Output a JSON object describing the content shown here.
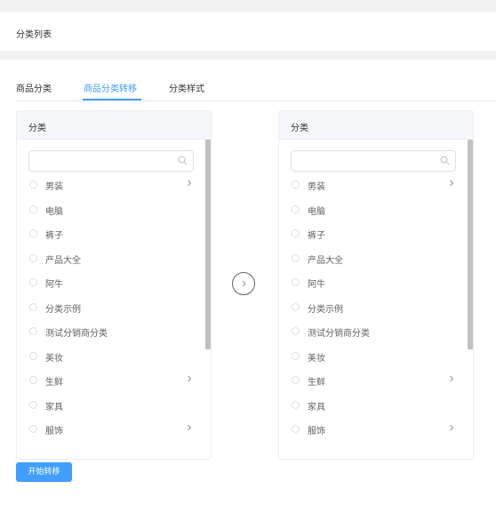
{
  "header": {
    "title": "分类列表"
  },
  "tabs": [
    {
      "label": "商品分类"
    },
    {
      "label": "商品分类转移"
    },
    {
      "label": "分类样式"
    }
  ],
  "colors": {
    "accent": "#409eff",
    "header_bg": "#f5f7fa",
    "page_bg": "#f2f2f2"
  },
  "left_panel": {
    "header": "分类",
    "items": [
      {
        "label": "男装",
        "has_children": true
      },
      {
        "label": "电脑",
        "has_children": false
      },
      {
        "label": "裤子",
        "has_children": false
      },
      {
        "label": "产品大全",
        "has_children": false
      },
      {
        "label": "阿牛",
        "has_children": false
      },
      {
        "label": "分类示例",
        "has_children": false
      },
      {
        "label": "测试分销商分类",
        "has_children": false
      },
      {
        "label": "美妆",
        "has_children": false
      },
      {
        "label": "生鲜",
        "has_children": true
      },
      {
        "label": "家具",
        "has_children": false
      },
      {
        "label": "服饰",
        "has_children": true
      }
    ]
  },
  "right_panel": {
    "header": "分类",
    "items": [
      {
        "label": "男装",
        "has_children": true
      },
      {
        "label": "电脑",
        "has_children": false
      },
      {
        "label": "裤子",
        "has_children": false
      },
      {
        "label": "产品大全",
        "has_children": false
      },
      {
        "label": "阿牛",
        "has_children": false
      },
      {
        "label": "分类示例",
        "has_children": false
      },
      {
        "label": "测试分销商分类",
        "has_children": false
      },
      {
        "label": "美妆",
        "has_children": false
      },
      {
        "label": "生鲜",
        "has_children": true
      },
      {
        "label": "家具",
        "has_children": false
      },
      {
        "label": "服饰",
        "has_children": true
      }
    ]
  },
  "icons": {
    "search": "search-icon",
    "transfer": "chevron-right-icon",
    "expand": "chevron-right-icon"
  },
  "actions": {
    "start_transfer": "开始转移"
  }
}
